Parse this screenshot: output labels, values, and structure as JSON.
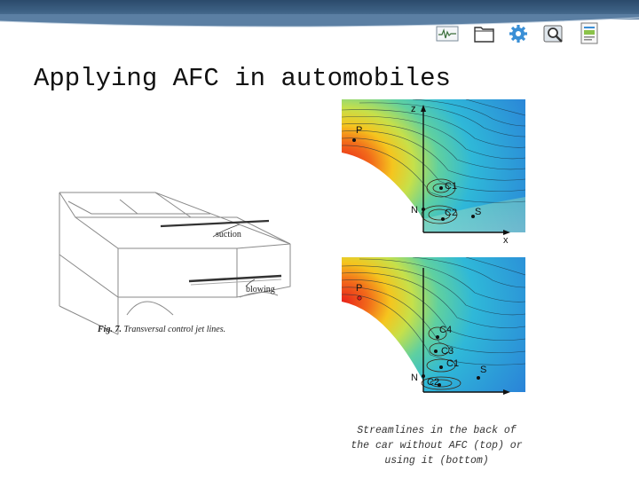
{
  "slide": {
    "title": "Applying AFC in automobiles",
    "caption_lines": [
      "Streamlines in the back of",
      "the car without AFC (top) or",
      "using it (bottom)"
    ]
  },
  "toolbar": {
    "icons": [
      "chart-icon",
      "folder-icon",
      "gear-icon",
      "magnifier-icon",
      "document-icon"
    ]
  },
  "sketch": {
    "suction_label": "suction",
    "blowing_label": "blowing",
    "fig_label": "Fig. 7.",
    "fig_caption": "Transversal control jet lines."
  },
  "flow_top": {
    "axis_z": "z",
    "axis_x": "x",
    "point_p": "P",
    "point_n": "N",
    "point_s": "S",
    "vortex_1": "C1",
    "vortex_2": "C2"
  },
  "flow_bottom": {
    "point_p": "P",
    "point_n": "N",
    "point_s": "S",
    "vortex_4": "C4",
    "vortex_3": "C3",
    "vortex_1": "C1",
    "vortex_2": "C2"
  },
  "colors": {
    "header": "#3e6285",
    "flow_hot": "#e8201a",
    "flow_cool": "#2fa0e0"
  }
}
